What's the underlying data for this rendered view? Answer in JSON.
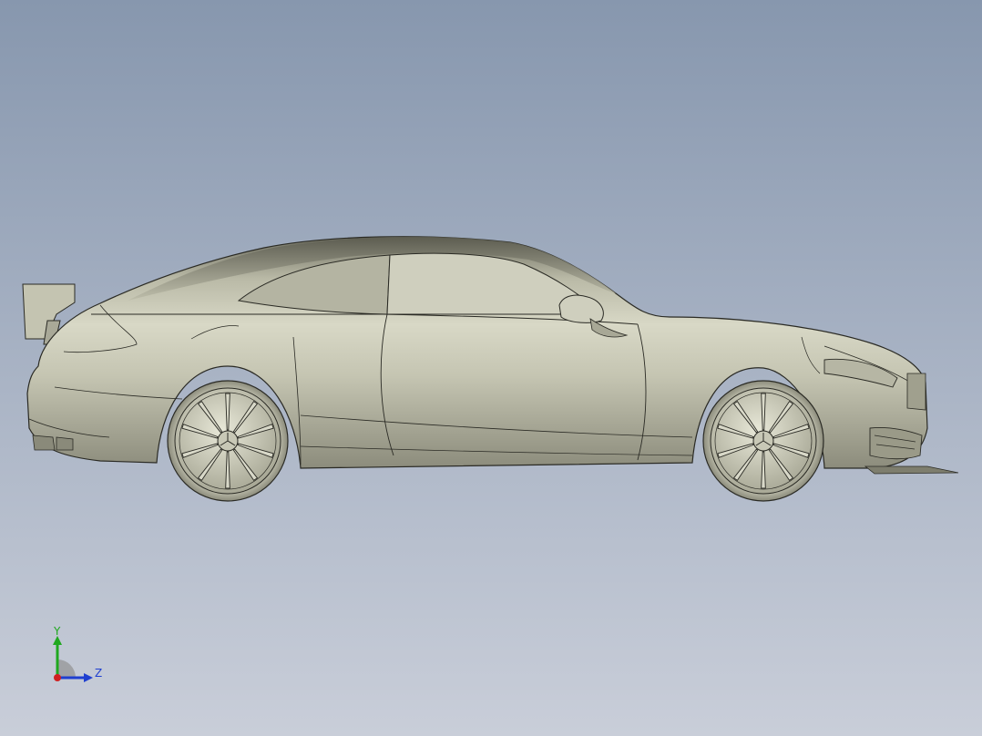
{
  "viewport": {
    "background_top": "#8797ae",
    "background_bottom": "#c9ced9",
    "model_color": "#c9c9b6",
    "edge_color": "#2a2a24"
  },
  "model": {
    "name": "car-body",
    "parts": [
      "rear-wing",
      "rear-wheel",
      "front-wheel",
      "side-mirror",
      "front-splitter"
    ]
  },
  "triad": {
    "y_label": "Y",
    "z_label": "Z",
    "y_color": "#1fa81f",
    "z_color": "#1f3fd0",
    "x_color": "#d02020"
  }
}
